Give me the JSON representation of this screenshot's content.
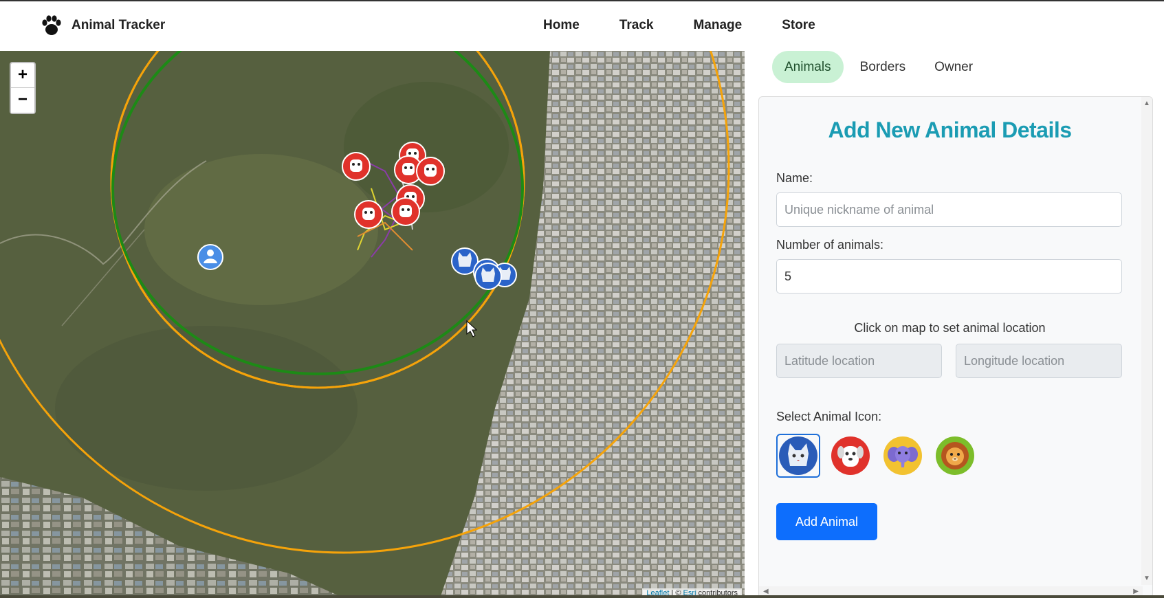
{
  "app": {
    "title": "Animal Tracker",
    "logo_icon": "paw-icon"
  },
  "nav": {
    "items": [
      "Home",
      "Track",
      "Manage",
      "Store"
    ]
  },
  "map": {
    "zoom_in": "+",
    "zoom_out": "−",
    "attribution_leaflet": "Leaflet",
    "attribution_sep": " | © ",
    "attribution_esri": "Esri",
    "attribution_tail": " contributors",
    "colors": {
      "inner_border": "#1d8a16",
      "outer_border": "#f5a30a",
      "dog_marker": "#e0322b",
      "cat_marker": "#2a63c9",
      "owner_marker": "#4a8ee6"
    }
  },
  "tabs": [
    {
      "label": "Animals",
      "active": true
    },
    {
      "label": "Borders",
      "active": false
    },
    {
      "label": "Owner",
      "active": false
    }
  ],
  "form": {
    "title": "Add New Animal Details",
    "name_label": "Name:",
    "name_placeholder": "Unique nickname of animal",
    "count_label": "Number of animals:",
    "count_value": "5",
    "location_hint": "Click on map to set animal location",
    "lat_placeholder": "Latitude location",
    "lng_placeholder": "Longitude location",
    "icon_label": "Select Animal Icon:",
    "icons": [
      "cat-icon",
      "dog-icon",
      "elephant-icon",
      "lion-icon"
    ],
    "selected_icon": "cat-icon",
    "submit_label": "Add Animal"
  }
}
